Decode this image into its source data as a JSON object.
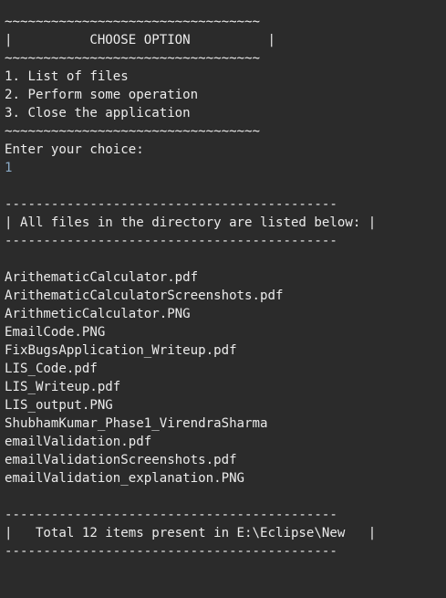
{
  "colors": {
    "background": "#2b2b2b",
    "text": "#ebebeb",
    "user_input": "#8aa9c5"
  },
  "menu": {
    "border_top": "~~~~~~~~~~~~~~~~~~~~~~~~~~~~~~~~~",
    "title_row": "|          CHOOSE OPTION          |",
    "border_mid": "~~~~~~~~~~~~~~~~~~~~~~~~~~~~~~~~~",
    "options": [
      "1. List of files",
      "2. Perform some operation",
      "3. Close the application"
    ],
    "border_bottom": "~~~~~~~~~~~~~~~~~~~~~~~~~~~~~~~~~",
    "prompt": "Enter your choice:",
    "user_input": "1"
  },
  "listing": {
    "border_top": "-------------------------------------------",
    "header_row": "| All files in the directory are listed below: |",
    "border_bottom": "-------------------------------------------",
    "files": [
      "ArithematicCalculator.pdf",
      "ArithematicCalculatorScreenshots.pdf",
      "ArithmeticCalculator.PNG",
      "EmailCode.PNG",
      "FixBugsApplication_Writeup.pdf",
      "LIS_Code.pdf",
      "LIS_Writeup.pdf",
      "LIS_output.PNG",
      "ShubhamKumar_Phase1_VirendraSharma",
      "emailValidation.pdf",
      "emailValidationScreenshots.pdf",
      "emailValidation_explanation.PNG"
    ]
  },
  "summary": {
    "border_top": "-------------------------------------------",
    "total_row": "|   Total 12 items present in E:\\Eclipse\\New   |",
    "border_bottom": "-------------------------------------------"
  }
}
